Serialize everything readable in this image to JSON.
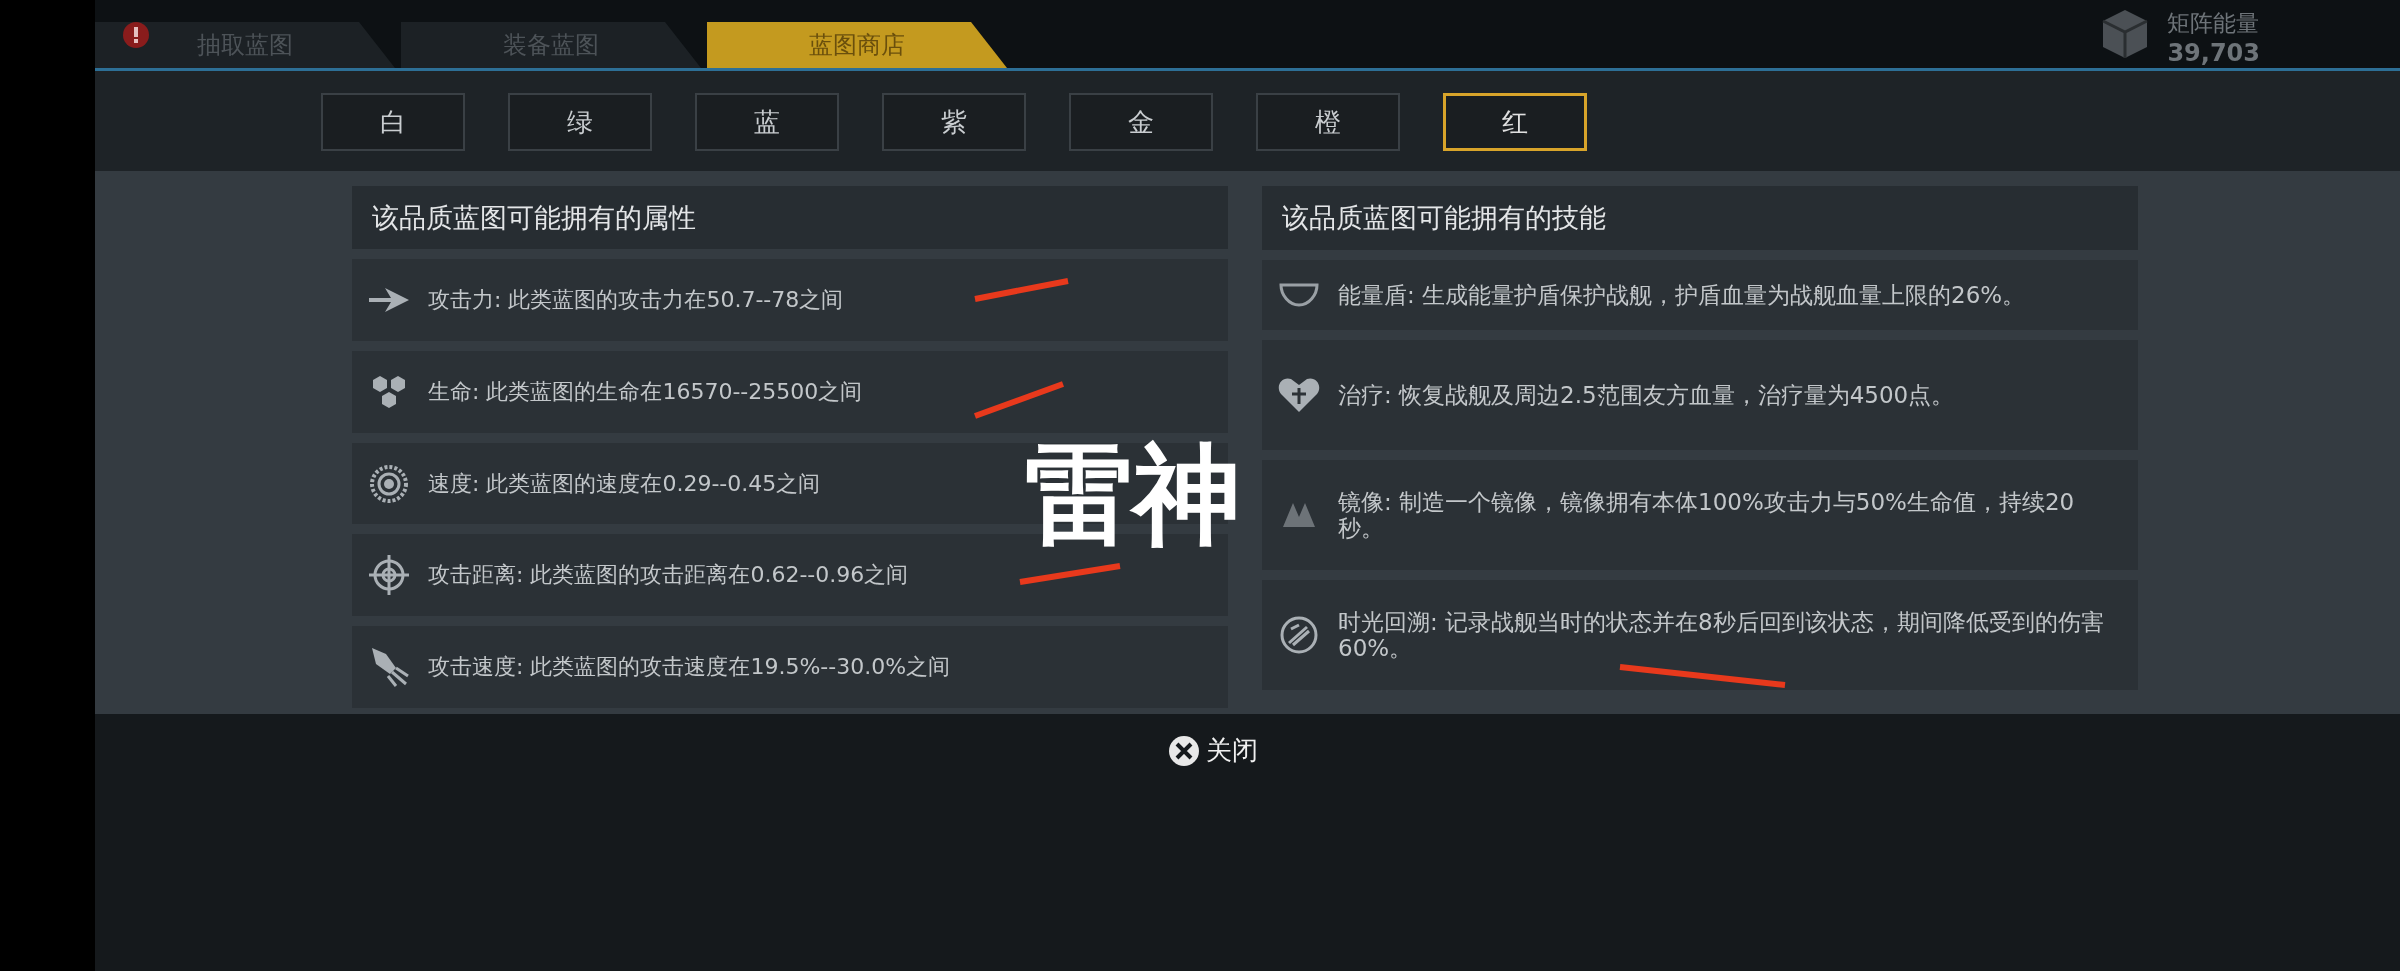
{
  "top_tabs": [
    {
      "label": "抽取蓝图",
      "selected": false,
      "alert": true
    },
    {
      "label": "装备蓝图",
      "selected": false,
      "alert": false
    },
    {
      "label": "蓝图商店",
      "selected": true,
      "alert": false
    }
  ],
  "currency": {
    "label": "矩阵能量",
    "value": "39,703"
  },
  "quality_tabs": [
    {
      "label": "白",
      "selected": false
    },
    {
      "label": "绿",
      "selected": false
    },
    {
      "label": "蓝",
      "selected": false
    },
    {
      "label": "紫",
      "selected": false
    },
    {
      "label": "金",
      "selected": false
    },
    {
      "label": "橙",
      "selected": false
    },
    {
      "label": "红",
      "selected": true
    }
  ],
  "attributes": {
    "title": "该品质蓝图可能拥有的属性",
    "rows": [
      {
        "kind": "attack",
        "text": "攻击力: 此类蓝图的攻击力在50.7--78之间"
      },
      {
        "kind": "life",
        "text": "生命: 此类蓝图的生命在16570--25500之间"
      },
      {
        "kind": "speed",
        "text": "速度: 此类蓝图的速度在0.29--0.45之间"
      },
      {
        "kind": "range",
        "text": "攻击距离: 此类蓝图的攻击距离在0.62--0.96之间"
      },
      {
        "kind": "rate",
        "text": "攻击速度: 此类蓝图的攻击速度在19.5%--30.0%之间"
      }
    ]
  },
  "skills": {
    "title": "该品质蓝图可能拥有的技能",
    "rows": [
      {
        "kind": "shield",
        "text": "能量盾: 生成能量护盾保护战舰，护盾血量为战舰血量上限的26%。"
      },
      {
        "kind": "heal",
        "text": "治疗: 恢复战舰及周边2.5范围友方血量，治疗量为4500点。"
      },
      {
        "kind": "mirror",
        "text": "镜像: 制造一个镜像，镜像拥有本体100%攻击力与50%生命值，持续20秒。"
      },
      {
        "kind": "rewind",
        "text": "时光回溯: 记录战舰当时的状态并在8秒后回到该状态，期间降低受到的伤害60%。"
      }
    ]
  },
  "close_button": {
    "label": "关闭"
  },
  "caption": "雷神"
}
